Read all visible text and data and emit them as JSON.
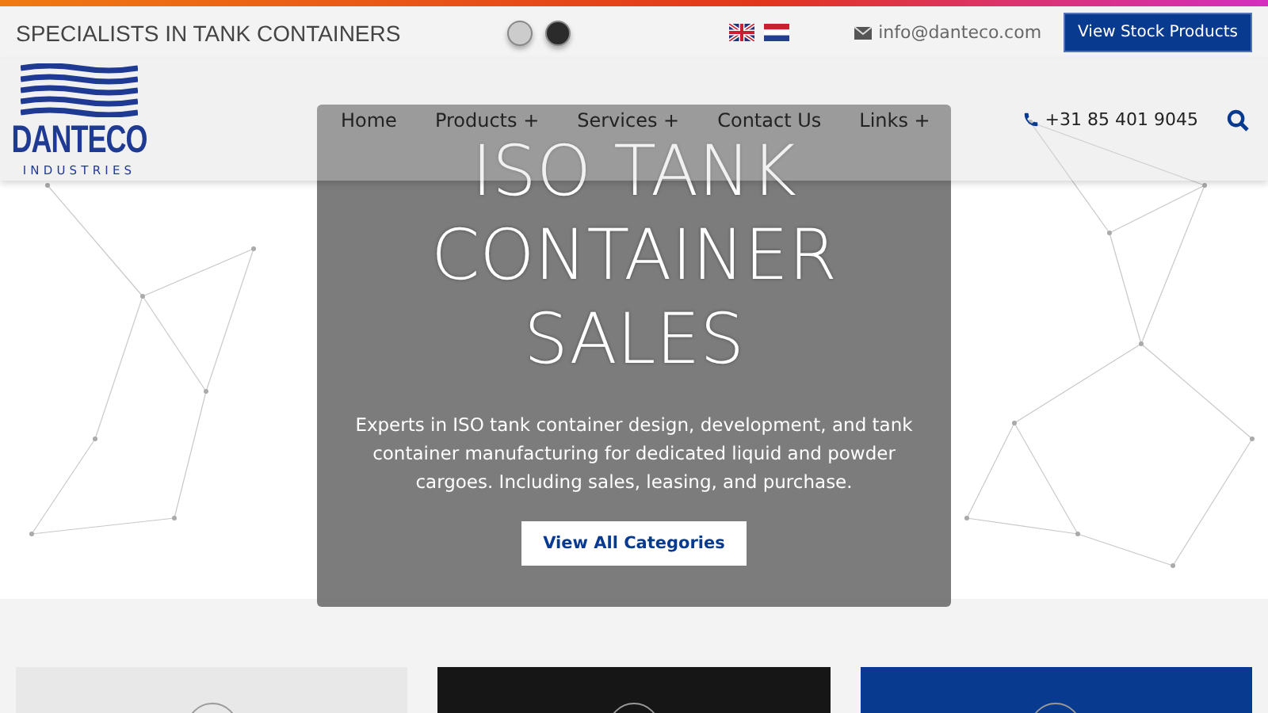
{
  "top_bar": {
    "tagline": "SPECIALISTS IN TANK CONTAINERS",
    "email": "info@danteco.com",
    "button": "View Stock Products"
  },
  "header": {
    "logo": {
      "name": "DANTECO",
      "subtitle": "INDUSTRIES"
    },
    "nav": [
      "Home",
      "Products +",
      "Services +",
      "Contact Us",
      "Links +"
    ],
    "phone": "+31 85 401 9045"
  },
  "hero": {
    "title": "ISO TANK CONTAINER SALES",
    "text": "Experts in ISO tank container design, development, and tank container manufacturing for dedicated liquid and powder cargoes. Including sales, leasing, and purchase.",
    "button": "View All Categories"
  },
  "cards": [
    {
      "color": "#e8e8e8"
    },
    {
      "color": "#161616"
    },
    {
      "color": "#083a8f"
    }
  ]
}
